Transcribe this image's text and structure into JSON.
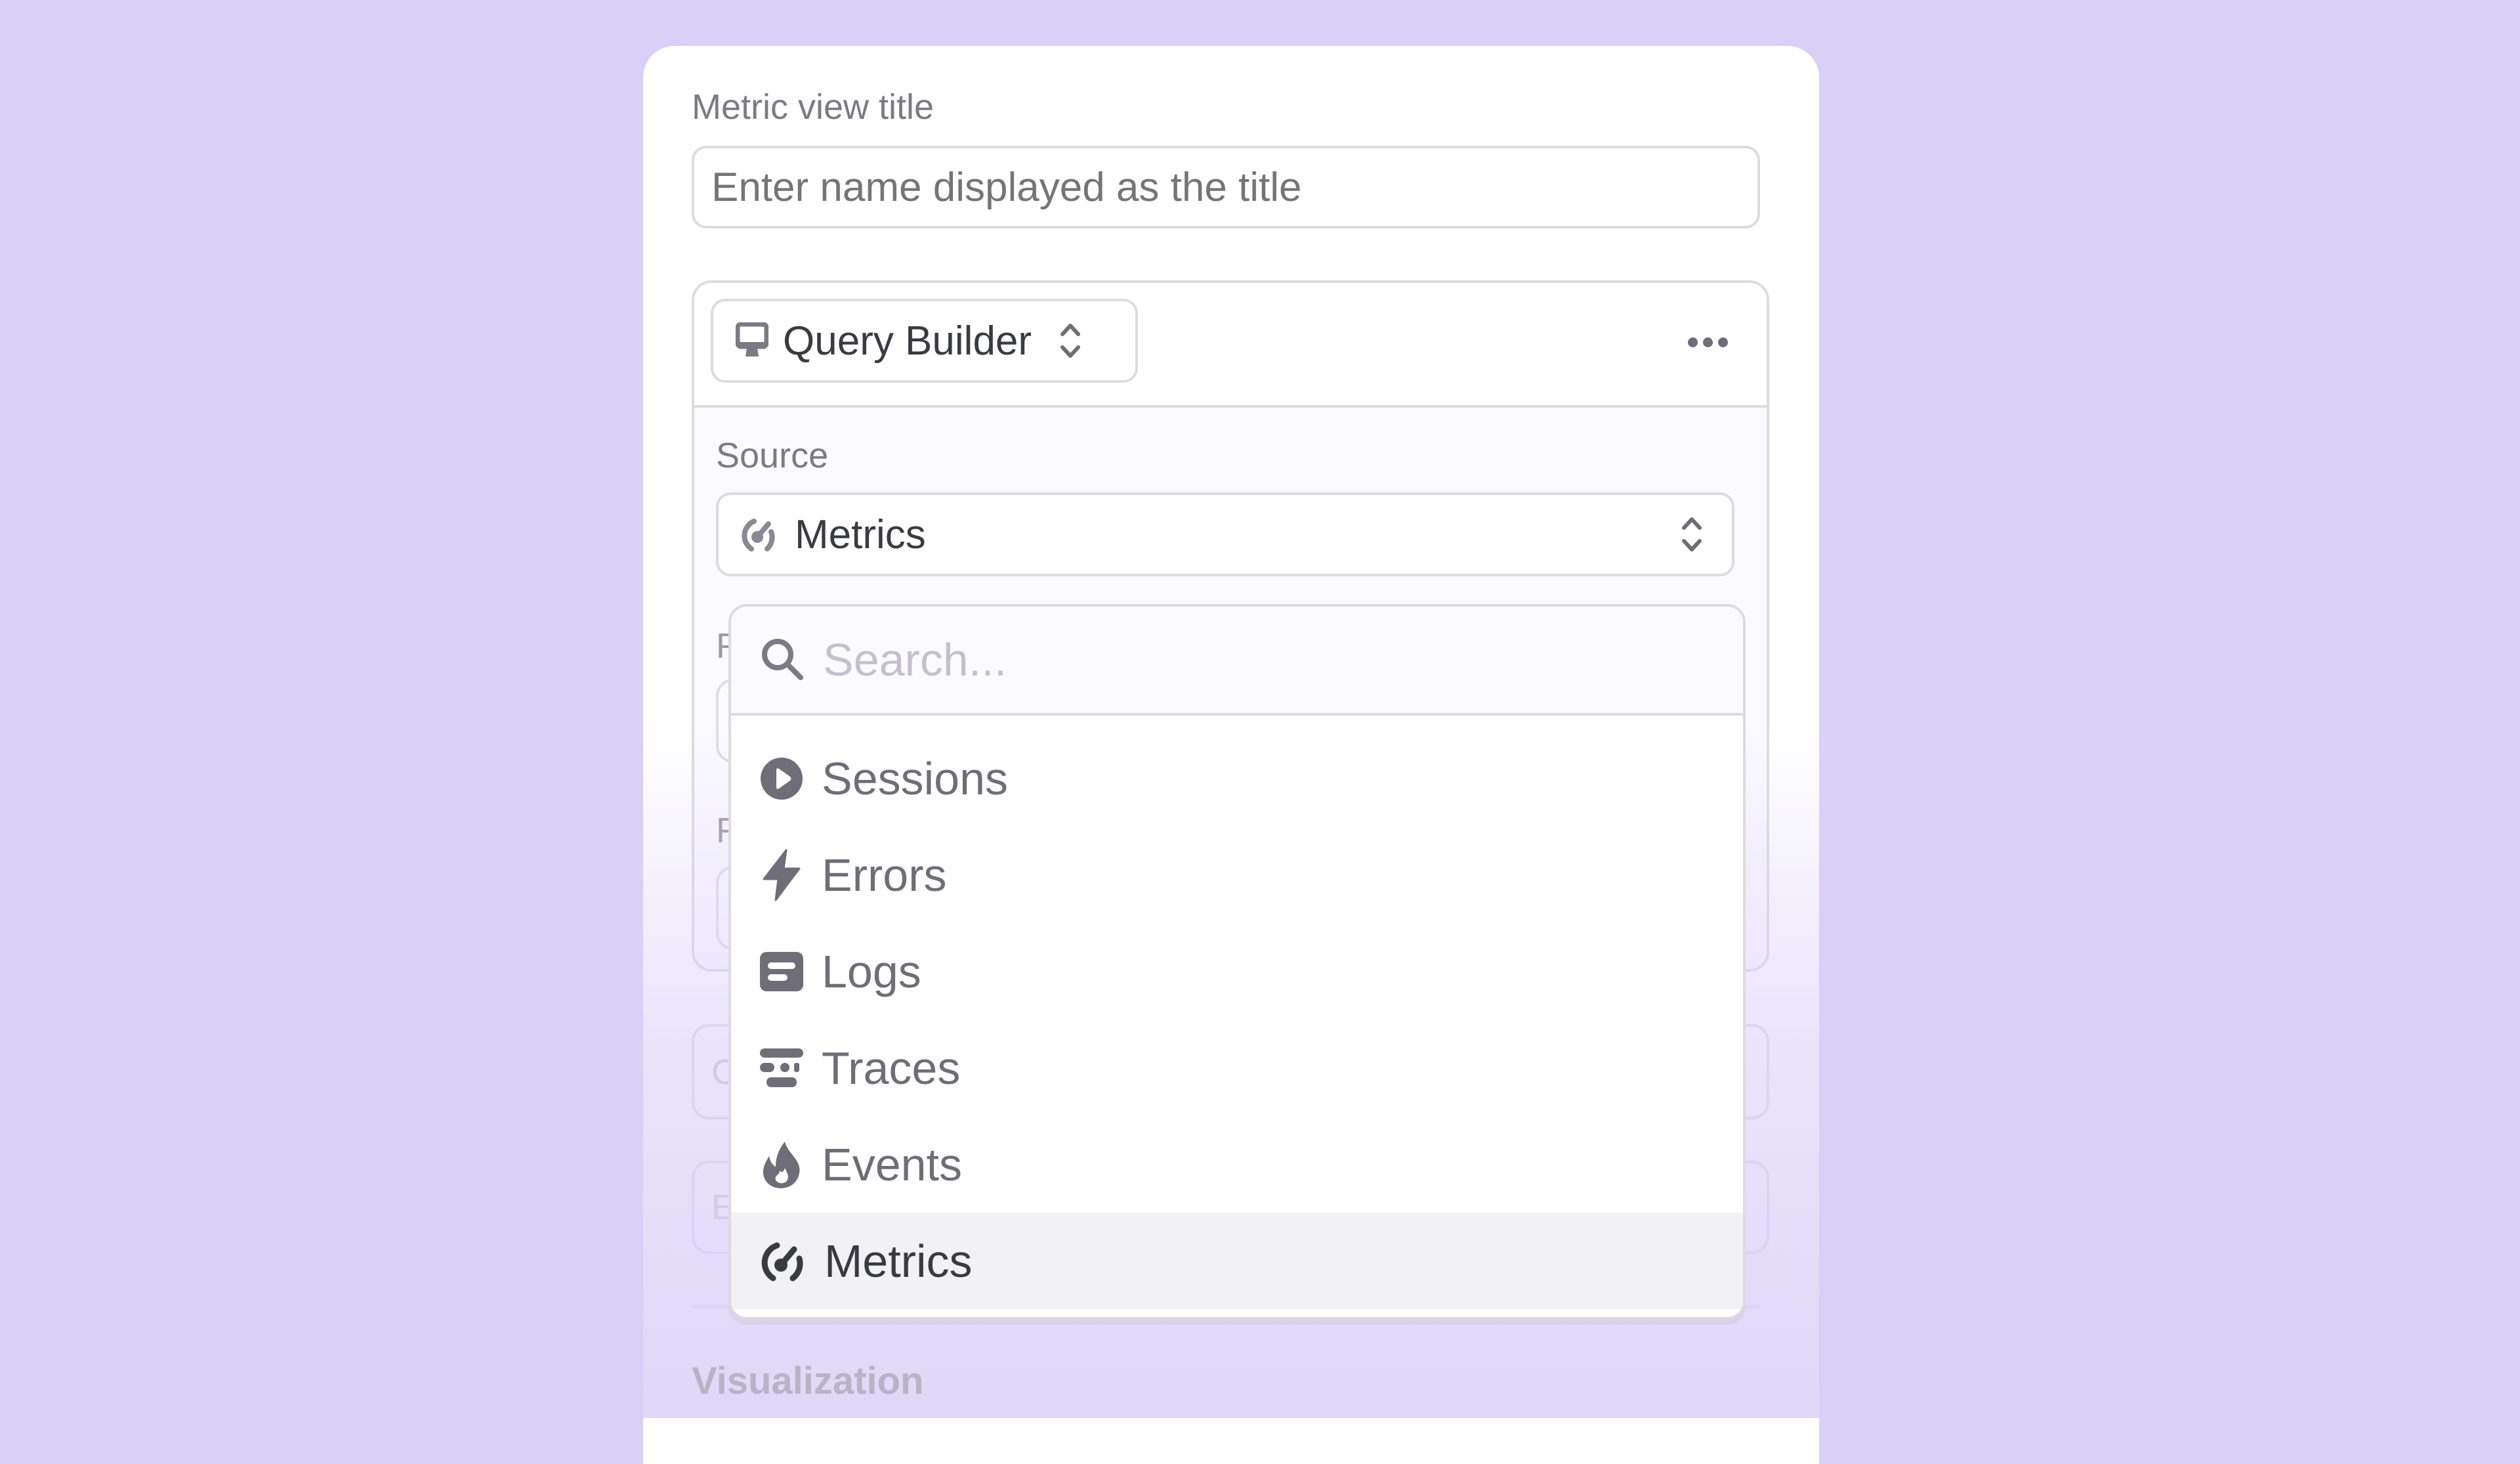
{
  "form": {
    "title_label": "Metric view title",
    "title_placeholder": "Enter name displayed as the title",
    "title_value": "",
    "visualization_label": "Visualization"
  },
  "query": {
    "mode_selector": {
      "label": "Query Builder",
      "icon": "monitor-icon",
      "indicator": "chevron-up-down-icon"
    },
    "more_menu_icon": "ellipsis-icon",
    "source_label": "Source",
    "source_value": "Metrics",
    "source_icon": "gauge-icon",
    "obscured_labels": [
      "F",
      "F"
    ],
    "obscured_fields": [
      "C",
      "E"
    ]
  },
  "dropdown": {
    "search_placeholder": "Search...",
    "search_value": "",
    "items": [
      {
        "label": "Sessions",
        "icon": "play-circle-icon",
        "selected": false
      },
      {
        "label": "Errors",
        "icon": "lightning-icon",
        "selected": false
      },
      {
        "label": "Logs",
        "icon": "log-card-icon",
        "selected": false
      },
      {
        "label": "Traces",
        "icon": "traces-icon",
        "selected": false
      },
      {
        "label": "Events",
        "icon": "flame-icon",
        "selected": false
      },
      {
        "label": "Metrics",
        "icon": "gauge-icon",
        "selected": true
      }
    ]
  },
  "colors": {
    "background": "#d9cff7",
    "text_primary": "#3a3a42",
    "text_secondary": "#6f6e78",
    "placeholder": "#c4c1cd",
    "border": "#dcdce0",
    "selected_row": "#f2f2f4"
  }
}
